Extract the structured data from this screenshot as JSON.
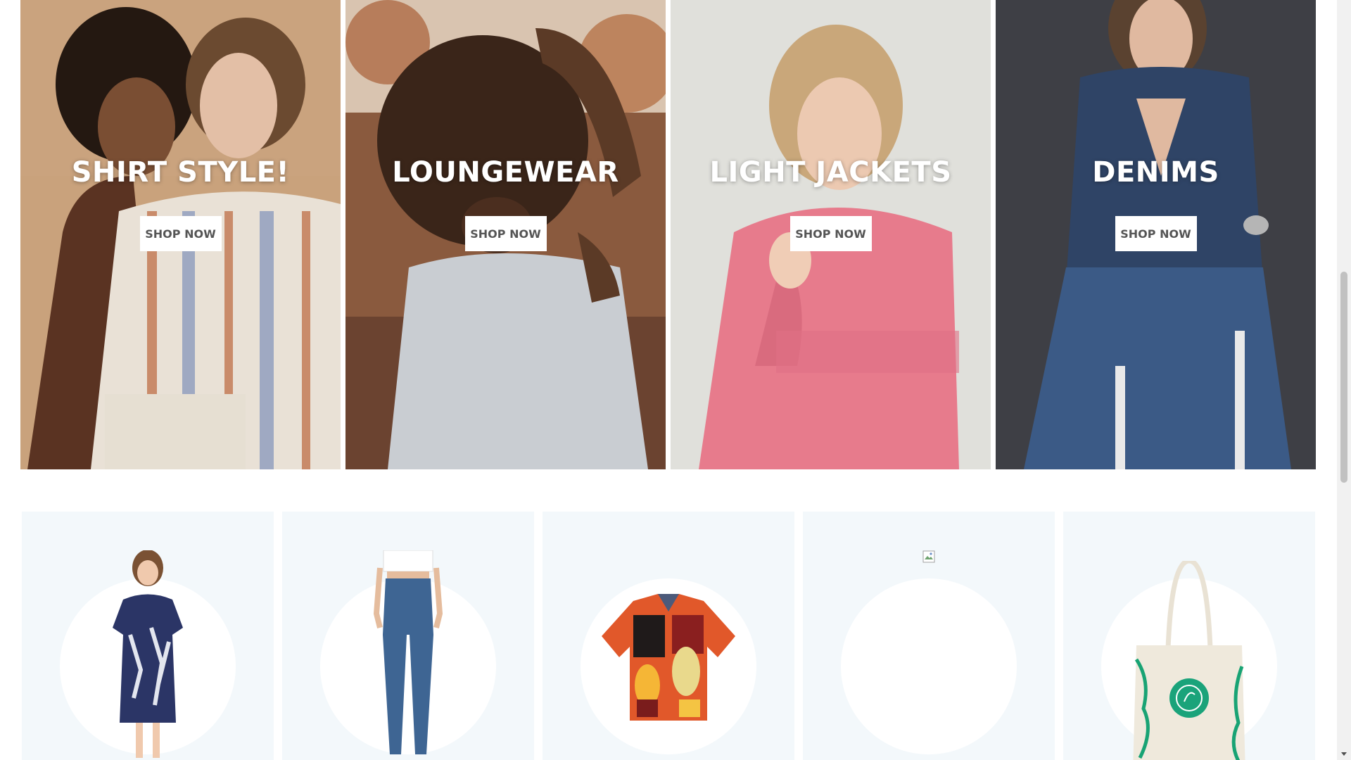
{
  "banners": [
    {
      "title": "SHIRT STYLE!",
      "button": "SHOP NOW"
    },
    {
      "title": "LOUNGEWEAR",
      "button": "SHOP NOW"
    },
    {
      "title": "LIGHT JACKETS",
      "button": "SHOP NOW"
    },
    {
      "title": "DENIMS",
      "button": "SHOP NOW"
    }
  ],
  "products": [
    {
      "icon": "printed-dress-image"
    },
    {
      "icon": "denim-jeggings-image"
    },
    {
      "icon": "printed-shirt-image"
    },
    {
      "icon": "broken-image-icon"
    },
    {
      "icon": "tote-bag-image"
    }
  ],
  "colors": {
    "card_background": "#f3f8fb",
    "banner_text": "#ffffff",
    "button_text": "#555555"
  }
}
